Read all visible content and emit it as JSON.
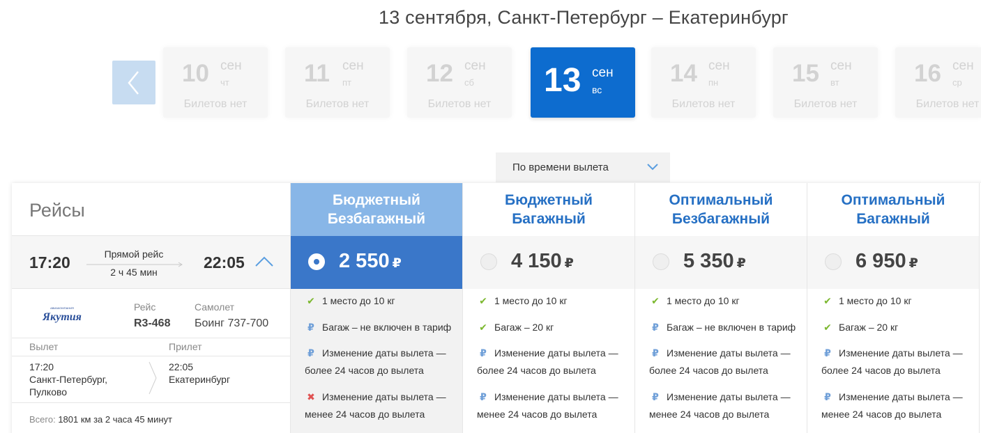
{
  "header": {
    "route_title": "13 сентября, Санкт-Петербург – Екатеринбург"
  },
  "date_strip": {
    "dates": [
      {
        "day": "10",
        "month": "сен",
        "weekday": "чт",
        "status": "Билетов нет"
      },
      {
        "day": "11",
        "month": "сен",
        "weekday": "пт",
        "status": "Билетов нет"
      },
      {
        "day": "12",
        "month": "сен",
        "weekday": "сб",
        "status": "Билетов нет"
      },
      {
        "day": "13",
        "month": "сен",
        "weekday": "вс",
        "status": ""
      },
      {
        "day": "14",
        "month": "сен",
        "weekday": "пн",
        "status": "Билетов нет"
      },
      {
        "day": "15",
        "month": "сен",
        "weekday": "вт",
        "status": "Билетов нет"
      },
      {
        "day": "16",
        "month": "сен",
        "weekday": "ср",
        "status": "Билетов нет"
      }
    ],
    "selected_index": 3
  },
  "sort": {
    "label": "По времени вылета"
  },
  "flights": {
    "heading": "Рейсы",
    "departure_time": "17:20",
    "arrival_time": "22:05",
    "flight_kind": "Прямой рейс",
    "duration": "2 ч 45 мин",
    "airline_logo_text": "Якутия",
    "flight_label": "Рейс",
    "flight_number": "R3-468",
    "aircraft_label": "Самолет",
    "aircraft": "Боинг 737-700",
    "departure_header": "Вылет",
    "arrival_header": "Прилет",
    "dep_time": "17:20",
    "dep_city": "Санкт-Петербург,",
    "dep_airport": "Пулково",
    "arr_time": "22:05",
    "arr_city": "Екатеринбург",
    "total_label": "Всего:",
    "total_value": "1801 км за 2 часа 45 минут"
  },
  "tariffs": [
    {
      "name_line1": "Бюджетный",
      "name_line2": "Безбагажный",
      "price": "2 550",
      "currency": "₽",
      "selected": true,
      "features": [
        {
          "icon": "check-icon",
          "line1": "1 место до 10 кг",
          "line2": ""
        },
        {
          "icon": "ruble-icon",
          "line1": "Багаж – не включен в тариф",
          "line2": ""
        },
        {
          "icon": "ruble-icon",
          "line1": "Изменение даты вылета —",
          "line2": "более 24 часов до вылета"
        },
        {
          "icon": "cross-icon",
          "line1": "Изменение даты вылета —",
          "line2": "менее 24 часов до вылета"
        }
      ]
    },
    {
      "name_line1": "Бюджетный",
      "name_line2": "Багажный",
      "price": "4 150",
      "currency": "₽",
      "selected": false,
      "features": [
        {
          "icon": "check-icon",
          "line1": "1 место до 10 кг",
          "line2": ""
        },
        {
          "icon": "check-icon",
          "line1": "Багаж – 20 кг",
          "line2": ""
        },
        {
          "icon": "ruble-icon",
          "line1": "Изменение даты вылета —",
          "line2": "более 24 часов до вылета"
        },
        {
          "icon": "ruble-icon",
          "line1": "Изменение даты вылета —",
          "line2": "менее 24 часов до вылета"
        }
      ]
    },
    {
      "name_line1": "Оптимальный",
      "name_line2": "Безбагажный",
      "price": "5 350",
      "currency": "₽",
      "selected": false,
      "features": [
        {
          "icon": "check-icon",
          "line1": "1 место до 10 кг",
          "line2": ""
        },
        {
          "icon": "ruble-icon",
          "line1": "Багаж – не включен в тариф",
          "line2": ""
        },
        {
          "icon": "ruble-icon",
          "line1": "Изменение даты вылета —",
          "line2": "более 24 часов до вылета"
        },
        {
          "icon": "ruble-icon",
          "line1": "Изменение даты вылета —",
          "line2": "менее 24 часов до вылета"
        }
      ]
    },
    {
      "name_line1": "Оптимальный",
      "name_line2": "Багажный",
      "price": "6 950",
      "currency": "₽",
      "selected": false,
      "features": [
        {
          "icon": "check-icon",
          "line1": "1 место до 10 кг",
          "line2": ""
        },
        {
          "icon": "check-icon",
          "line1": "Багаж – 20 кг",
          "line2": ""
        },
        {
          "icon": "ruble-icon",
          "line1": "Изменение даты вылета —",
          "line2": "более 24 часов до вылета"
        },
        {
          "icon": "ruble-icon",
          "line1": "Изменение даты вылета —",
          "line2": "менее 24 часов до вылета"
        }
      ]
    }
  ],
  "colors": {
    "accent": "#0d6ccf",
    "selected_header": "#88b6e7",
    "selected_price": "#3a77c9",
    "tariff_title": "#2670c4",
    "check": "#7cb82f",
    "cross": "#e05252"
  }
}
